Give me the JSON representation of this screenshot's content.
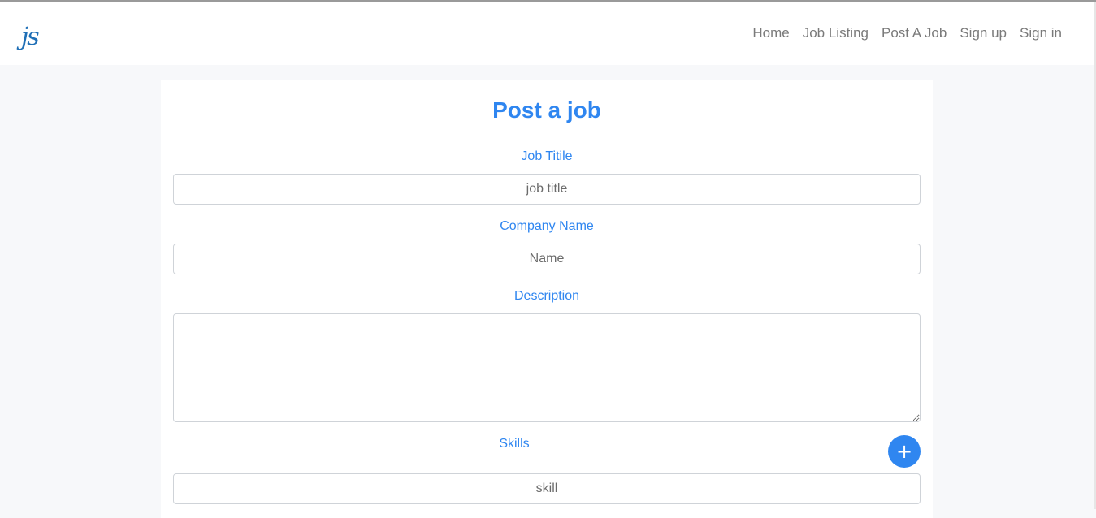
{
  "brand": {
    "logo_text": "js"
  },
  "nav": {
    "items": [
      "Home",
      "Job Listing",
      "Post A Job",
      "Sign up",
      "Sign in"
    ]
  },
  "form": {
    "title": "Post a job",
    "job_title": {
      "label": "Job Titile",
      "placeholder": "job title",
      "value": ""
    },
    "company_name": {
      "label": "Company Name",
      "placeholder": "Name",
      "value": ""
    },
    "description": {
      "label": "Description",
      "value": ""
    },
    "skills": {
      "label": "Skills",
      "placeholder": "skill",
      "add_button": "+"
    }
  },
  "colors": {
    "accent": "#2f86f0",
    "logo": "#1f6fb6",
    "nav_text": "#7a7a7a"
  }
}
